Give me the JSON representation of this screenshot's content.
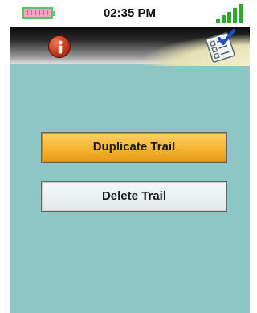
{
  "status_bar": {
    "time": "02:35 PM",
    "battery_icon": "battery-icon",
    "signal_icon": "signal-strength-icon"
  },
  "toolbar": {
    "info_icon": "info-icon",
    "checklist_icon": "checklist-icon"
  },
  "actions": {
    "duplicate_label": "Duplicate Trail",
    "delete_label": "Delete Trail"
  },
  "colors": {
    "background": "#8ec6c5",
    "primary_button": "#f5b531",
    "secondary_button": "#e8eef0"
  }
}
